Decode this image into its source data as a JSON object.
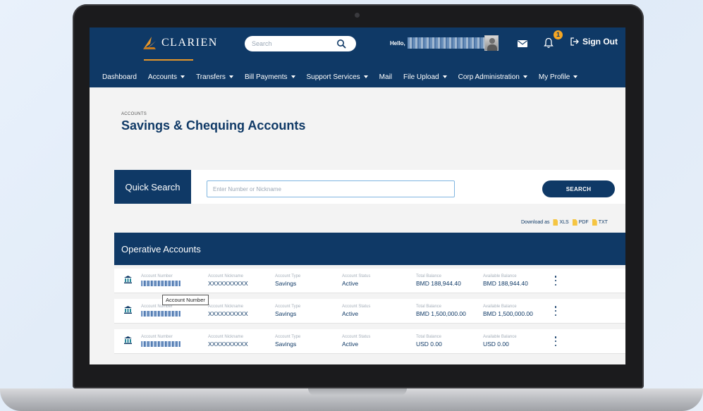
{
  "header": {
    "brand": "CLARIEN",
    "search_placeholder": "Search",
    "greeting": "Hello,",
    "notification_count": "1",
    "sign_out": "Sign Out"
  },
  "nav": [
    {
      "label": "Dashboard"
    },
    {
      "label": "Accounts"
    },
    {
      "label": "Transfers"
    },
    {
      "label": "Bill Payments"
    },
    {
      "label": "Support Services"
    },
    {
      "label": "Mail"
    },
    {
      "label": "File Upload"
    },
    {
      "label": "Corp Administration"
    },
    {
      "label": "My Profile"
    }
  ],
  "page": {
    "breadcrumb": "ACCOUNTS",
    "title": "Savings & Chequing Accounts"
  },
  "quick_search": {
    "label": "Quick Search",
    "placeholder": "Enter Number or Nickname",
    "button": "SEARCH"
  },
  "download": {
    "label": "Download as",
    "formats": [
      "XLS",
      "PDF",
      "TXT"
    ]
  },
  "section_title": "Operative Accounts",
  "column_labels": {
    "number": "Account Number",
    "nickname": "Account Nickname",
    "type": "Account Type",
    "status": "Account Status",
    "total": "Total Balance",
    "available": "Available Balance"
  },
  "accounts": [
    {
      "nickname": "XXXXXXXXXX",
      "type": "Savings",
      "status": "Active",
      "total": "BMD 188,944.40",
      "available": "BMD 188,944.40"
    },
    {
      "nickname": "XXXXXXXXXX",
      "type": "Savings",
      "status": "Active",
      "total": "BMD 1,500,000.00",
      "available": "BMD 1,500,000.00"
    },
    {
      "nickname": "XXXXXXXXXX",
      "type": "Savings",
      "status": "Active",
      "total": "USD 0.00",
      "available": "USD 0.00"
    }
  ],
  "tooltip": "Account Number",
  "colors": {
    "navy": "#0f3966",
    "accent_orange": "#e6962a",
    "badge_yellow": "#f5a623"
  }
}
